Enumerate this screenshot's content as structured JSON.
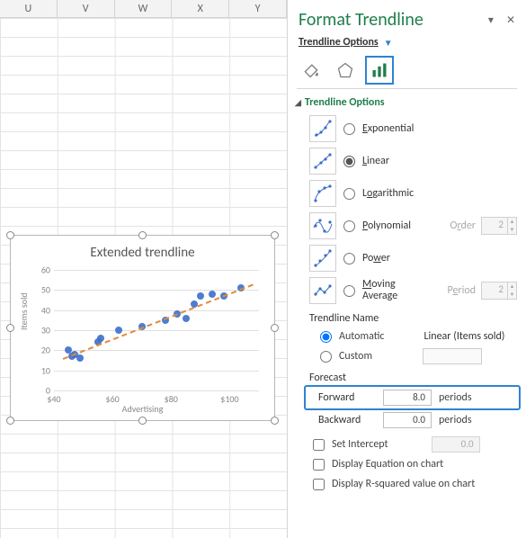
{
  "sheet": {
    "columns": [
      "U",
      "V",
      "W",
      "X",
      "Y"
    ]
  },
  "chart": {
    "title": "Extended trendline"
  },
  "chart_data": {
    "type": "scatter",
    "xlabel": "Advertising",
    "ylabel": "Items sold",
    "xlim": [
      40,
      110
    ],
    "ylim": [
      0,
      60
    ],
    "xticks": [
      "$40",
      "$60",
      "$80",
      "$100"
    ],
    "yticks": [
      0,
      10,
      20,
      30,
      40,
      50,
      60
    ],
    "series": [
      {
        "name": "Items sold",
        "points": [
          [
            45,
            20
          ],
          [
            46,
            17
          ],
          [
            47,
            18
          ],
          [
            49,
            16
          ],
          [
            55,
            24
          ],
          [
            56,
            26
          ],
          [
            62,
            30
          ],
          [
            70,
            32
          ],
          [
            78,
            35
          ],
          [
            82,
            38
          ],
          [
            85,
            36
          ],
          [
            88,
            43
          ],
          [
            90,
            47
          ],
          [
            94,
            48
          ],
          [
            98,
            47
          ],
          [
            104,
            51
          ]
        ]
      }
    ],
    "trendline": {
      "type": "linear",
      "x1": 43,
      "y1": 16,
      "x2": 108,
      "y2": 53
    }
  },
  "pane": {
    "title": "Format Trendline",
    "options_label": "Trendline Options",
    "section_head": "Trendline Options",
    "types": {
      "exponential": "Exponential",
      "linear": "Linear",
      "logarithmic": "Logarithmic",
      "polynomial": "Polynomial",
      "power": "Power",
      "moving_line1": "Moving",
      "moving_line2": "Average"
    },
    "selected_type": "linear",
    "order_label": "Order",
    "order_value": "2",
    "period_label": "Period",
    "period_value": "2",
    "name_head": "Trendline Name",
    "automatic_label": "Automatic",
    "automatic_value": "Linear (Items sold)",
    "custom_label": "Custom",
    "custom_value": "",
    "forecast_head": "Forecast",
    "forward_label": "Forward",
    "forward_value": "8.0",
    "backward_label": "Backward",
    "backward_value": "0.0",
    "periods_label": "periods",
    "set_intercept_label": "Set Intercept",
    "set_intercept_value": "0.0",
    "display_eq_label": "Display Equation on chart",
    "display_r2_label": "Display R-squared value on chart"
  }
}
